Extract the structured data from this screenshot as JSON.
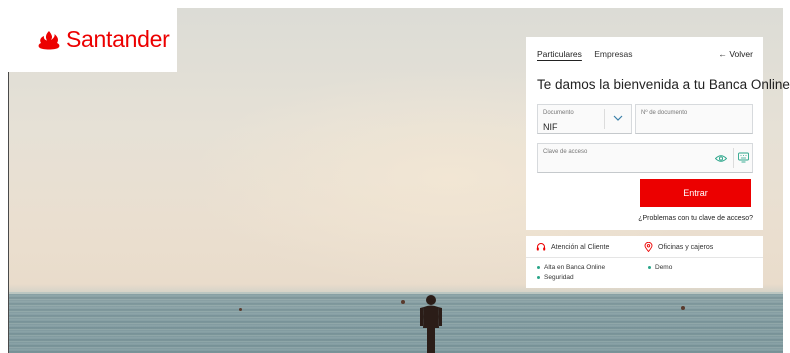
{
  "brand": {
    "name": "Santander",
    "color": "#ec0000"
  },
  "login": {
    "tabs": [
      {
        "label": "Particulares",
        "active": true
      },
      {
        "label": "Empresas",
        "active": false
      }
    ],
    "back_label": "← Volver",
    "title": "Te damos la bienvenida a tu Banca Online",
    "document_type": {
      "label": "Documento",
      "value": "NIF"
    },
    "document_number": {
      "label": "Nº de documento",
      "value": ""
    },
    "password": {
      "label": "Clave de acceso",
      "value": ""
    },
    "submit_label": "Entrar",
    "help_link": "¿Problemas con tu clave de acceso?"
  },
  "help": {
    "customer_service": "Atención al Cliente",
    "offices": "Oficinas y cajeros",
    "links": [
      "Alta en Banca Online",
      "Seguridad",
      "Demo"
    ],
    "accent_color": "#2aa58a"
  },
  "icons": [
    "santander-flame-icon",
    "chevron-down-icon",
    "eye-icon",
    "keyboard-icon",
    "headset-icon",
    "location-pin-icon"
  ]
}
